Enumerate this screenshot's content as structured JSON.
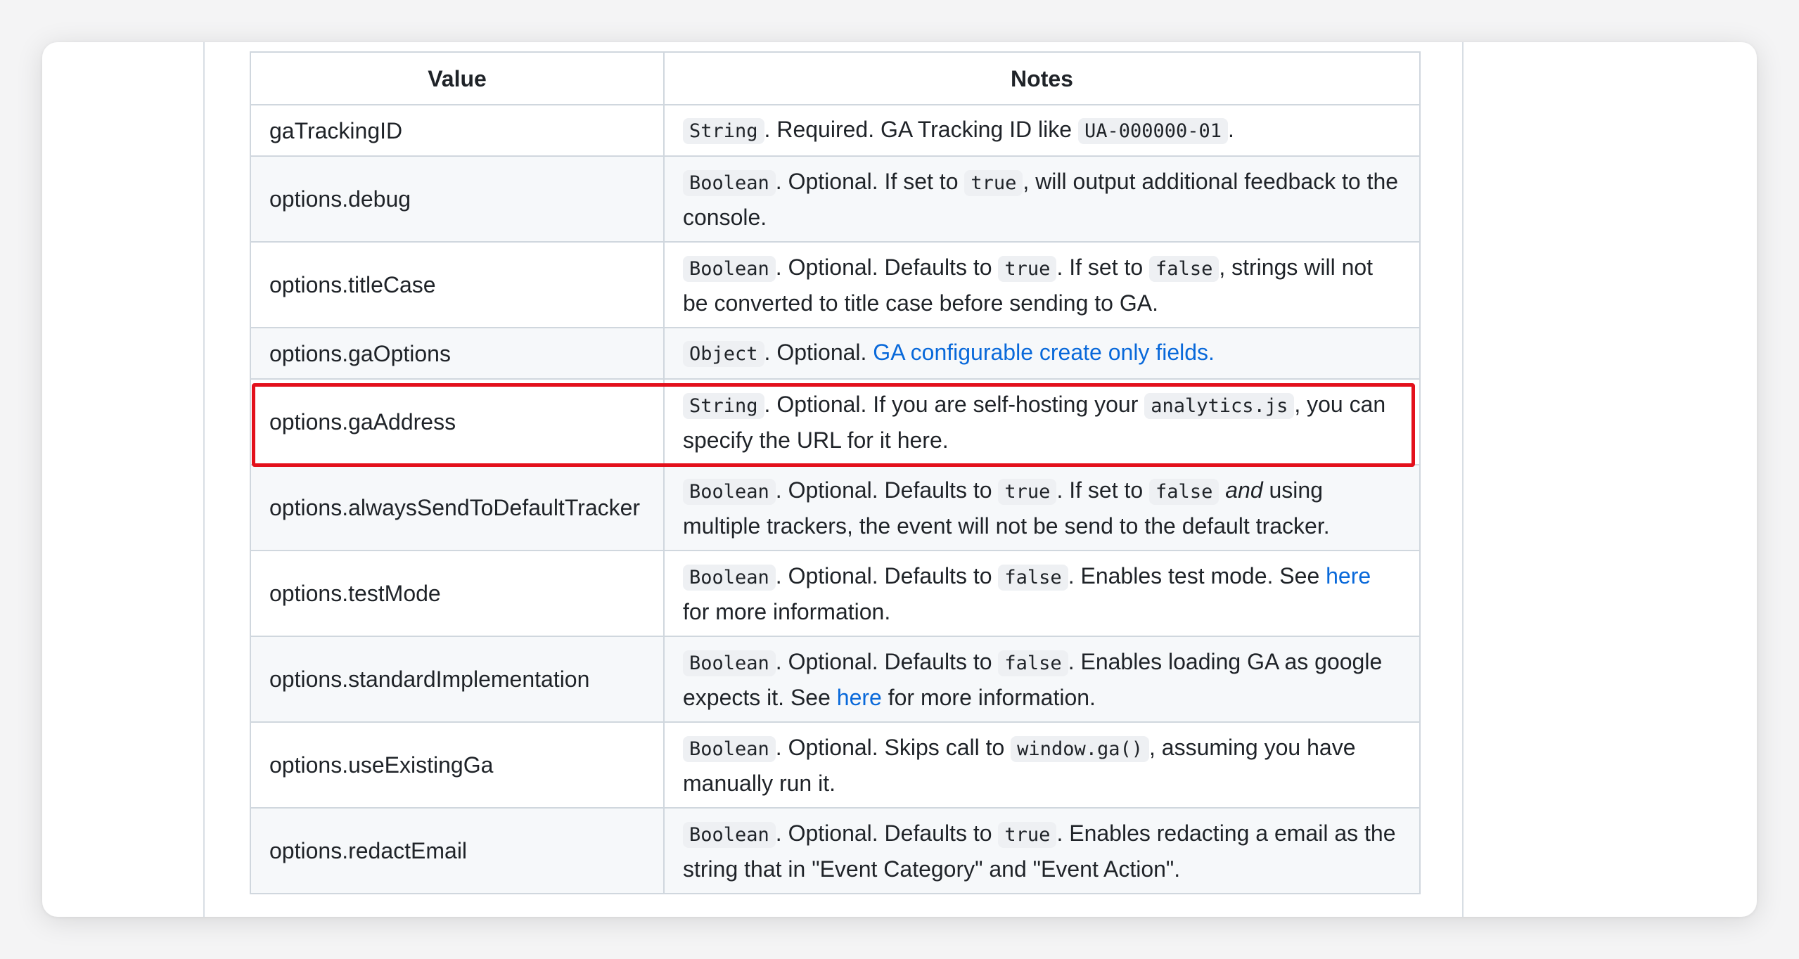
{
  "table": {
    "headers": {
      "value": "Value",
      "notes": "Notes"
    },
    "rows": [
      {
        "value": "gaTrackingID",
        "type": "String",
        "notes": [
          ". Required. GA Tracking ID like ",
          ".",
          ""
        ],
        "code1": "UA-000000-01"
      },
      {
        "value": "options.debug",
        "type": "Boolean",
        "notes": [
          ". Optional. If set to ",
          ", will output additional feedback to the console."
        ],
        "code1": "true"
      },
      {
        "value": "options.titleCase",
        "type": "Boolean",
        "notes": [
          ". Optional. Defaults to ",
          ". If set to ",
          ", strings will not be converted to title case before sending to GA."
        ],
        "code1": "true",
        "code2": "false"
      },
      {
        "value": "options.gaOptions",
        "type": "Object",
        "notes": [
          ". Optional. "
        ],
        "link": "GA configurable create only fields."
      },
      {
        "value": "options.gaAddress",
        "type": "String",
        "notes": [
          ". Optional. If you are self-hosting your ",
          ", you can specify the URL for it here."
        ],
        "code1": "analytics.js"
      },
      {
        "value": "options.alwaysSendToDefaultTracker",
        "type": "Boolean",
        "notes": [
          ". Optional. Defaults to ",
          ". If set to ",
          " ",
          " using multiple trackers, the event will not be send to the default tracker."
        ],
        "code1": "true",
        "code2": "false",
        "em": "and"
      },
      {
        "value": "options.testMode",
        "type": "Boolean",
        "notes": [
          ". Optional. Defaults to ",
          ". Enables test mode. See ",
          " for more information."
        ],
        "code1": "false",
        "link": "here"
      },
      {
        "value": "options.standardImplementation",
        "type": "Boolean",
        "notes": [
          ". Optional. Defaults to ",
          ". Enables loading GA as google expects it. See ",
          " for more information."
        ],
        "code1": "false",
        "link": "here"
      },
      {
        "value": "options.useExistingGa",
        "type": "Boolean",
        "notes": [
          ". Optional. Skips call to ",
          ", assuming you have manually run it."
        ],
        "code1": "window.ga()"
      },
      {
        "value": "options.redactEmail",
        "type": "Boolean",
        "notes": [
          ". Optional. Defaults to ",
          ". Enables redacting a email as the string that in \"Event Category\" and \"Event Action\"."
        ],
        "code1": "true"
      }
    ]
  },
  "colors": {
    "highlight_border": "#e3101b",
    "link": "#0969da"
  }
}
